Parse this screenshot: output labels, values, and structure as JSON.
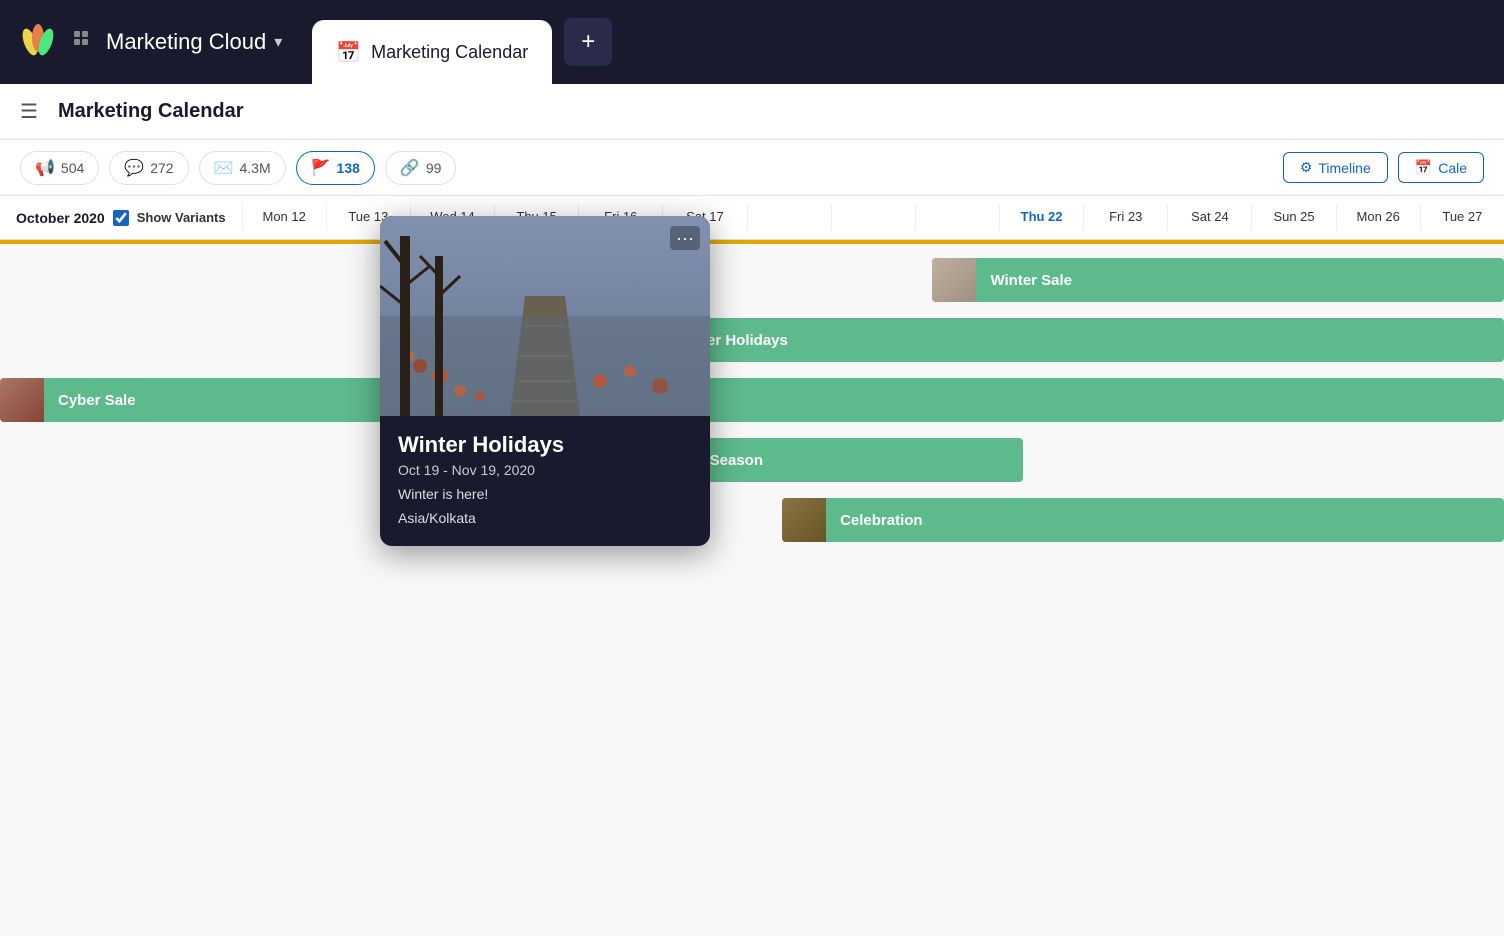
{
  "app": {
    "logo_colors": [
      "#e8d44d",
      "#e87d4d",
      "#4de87d"
    ],
    "name": "Marketing Cloud",
    "tab_label": "Marketing Calendar",
    "add_btn_label": "+"
  },
  "header": {
    "hamburger": "☰",
    "title": "Marketing Calendar"
  },
  "stats": [
    {
      "icon": "📢",
      "value": "504",
      "active": false
    },
    {
      "icon": "💬",
      "value": "272",
      "active": false
    },
    {
      "icon": "✉️",
      "value": "4.3M",
      "active": false
    },
    {
      "icon": "🚩",
      "value": "138",
      "active": true
    },
    {
      "icon": "🔗",
      "value": "99",
      "active": false
    }
  ],
  "views": [
    {
      "icon": "⚙",
      "label": "Timeline"
    },
    {
      "icon": "📅",
      "label": "Cale"
    }
  ],
  "calendar": {
    "month_label": "October 2020",
    "show_variants": true,
    "show_variants_label": "Show Variants",
    "dates": [
      {
        "day": "Mon 12",
        "today": false
      },
      {
        "day": "Tue 13",
        "today": false
      },
      {
        "day": "Wed 14",
        "today": false
      },
      {
        "day": "Thu 15",
        "today": false
      },
      {
        "day": "Fri 16",
        "today": false
      },
      {
        "day": "Sat 17",
        "today": false
      },
      {
        "day": "",
        "today": false
      },
      {
        "day": "",
        "today": false
      },
      {
        "day": "",
        "today": false
      },
      {
        "day": "Thu 22",
        "today": true
      },
      {
        "day": "Fri 23",
        "today": false
      },
      {
        "day": "Sat 24",
        "today": false
      },
      {
        "day": "Sun 25",
        "today": false
      },
      {
        "day": "Mon 26",
        "today": false
      },
      {
        "day": "Tue 27",
        "today": false
      }
    ]
  },
  "popup": {
    "title": "Winter Holidays",
    "dates": "Oct 19 - Nov 19, 2020",
    "description": "Winter is here!",
    "timezone": "Asia/Kolkata",
    "more_btn": "···"
  },
  "events": [
    {
      "id": "winter-sale",
      "name": "Winter Sale",
      "color": "green",
      "has_thumb": true,
      "thumb_color": "#b0a090"
    },
    {
      "id": "winter-holidays",
      "name": "Winter Holidays",
      "color": "green",
      "has_thumb": true,
      "thumb_color": "#6a4040"
    },
    {
      "id": "cyber-sale",
      "name": "Cyber Sale",
      "color": "green",
      "has_thumb": true,
      "thumb_color": "#885544"
    },
    {
      "id": "new-season",
      "name": "New Season",
      "color": "green",
      "has_thumb": true,
      "thumb_color": "#887799"
    },
    {
      "id": "celebration",
      "name": "Celebration",
      "color": "green",
      "has_thumb": true,
      "thumb_color": "#776644"
    }
  ]
}
